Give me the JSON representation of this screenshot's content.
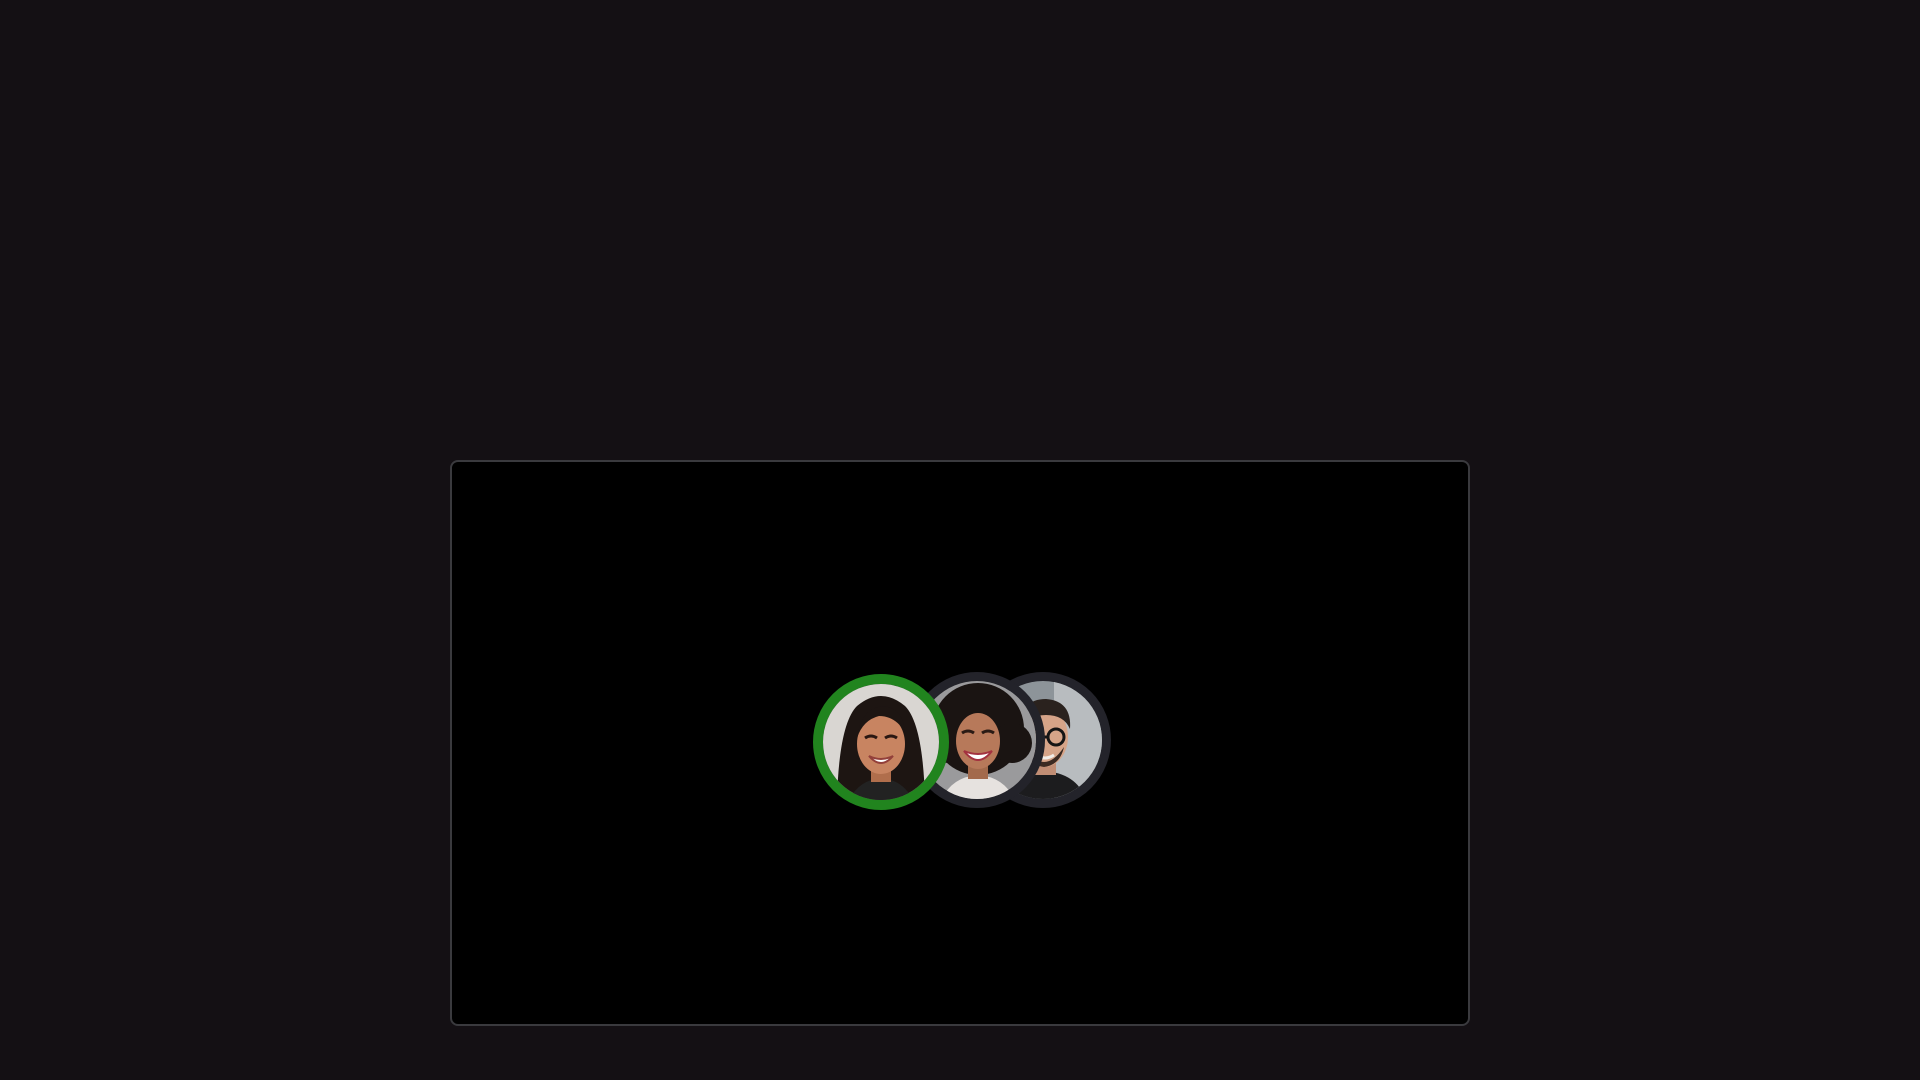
{
  "colors": {
    "page_background": "#141014",
    "panel_background": "#000000",
    "speaking_ring": "#21841e",
    "idle_ring": "#23232a"
  },
  "call": {
    "participants": [
      {
        "avatar": "avatar-photo-woman-dark-hair",
        "speaking": true
      },
      {
        "avatar": "avatar-photo-woman-curly-hair",
        "speaking": false
      },
      {
        "avatar": "avatar-photo-man-glasses",
        "speaking": false
      }
    ]
  }
}
